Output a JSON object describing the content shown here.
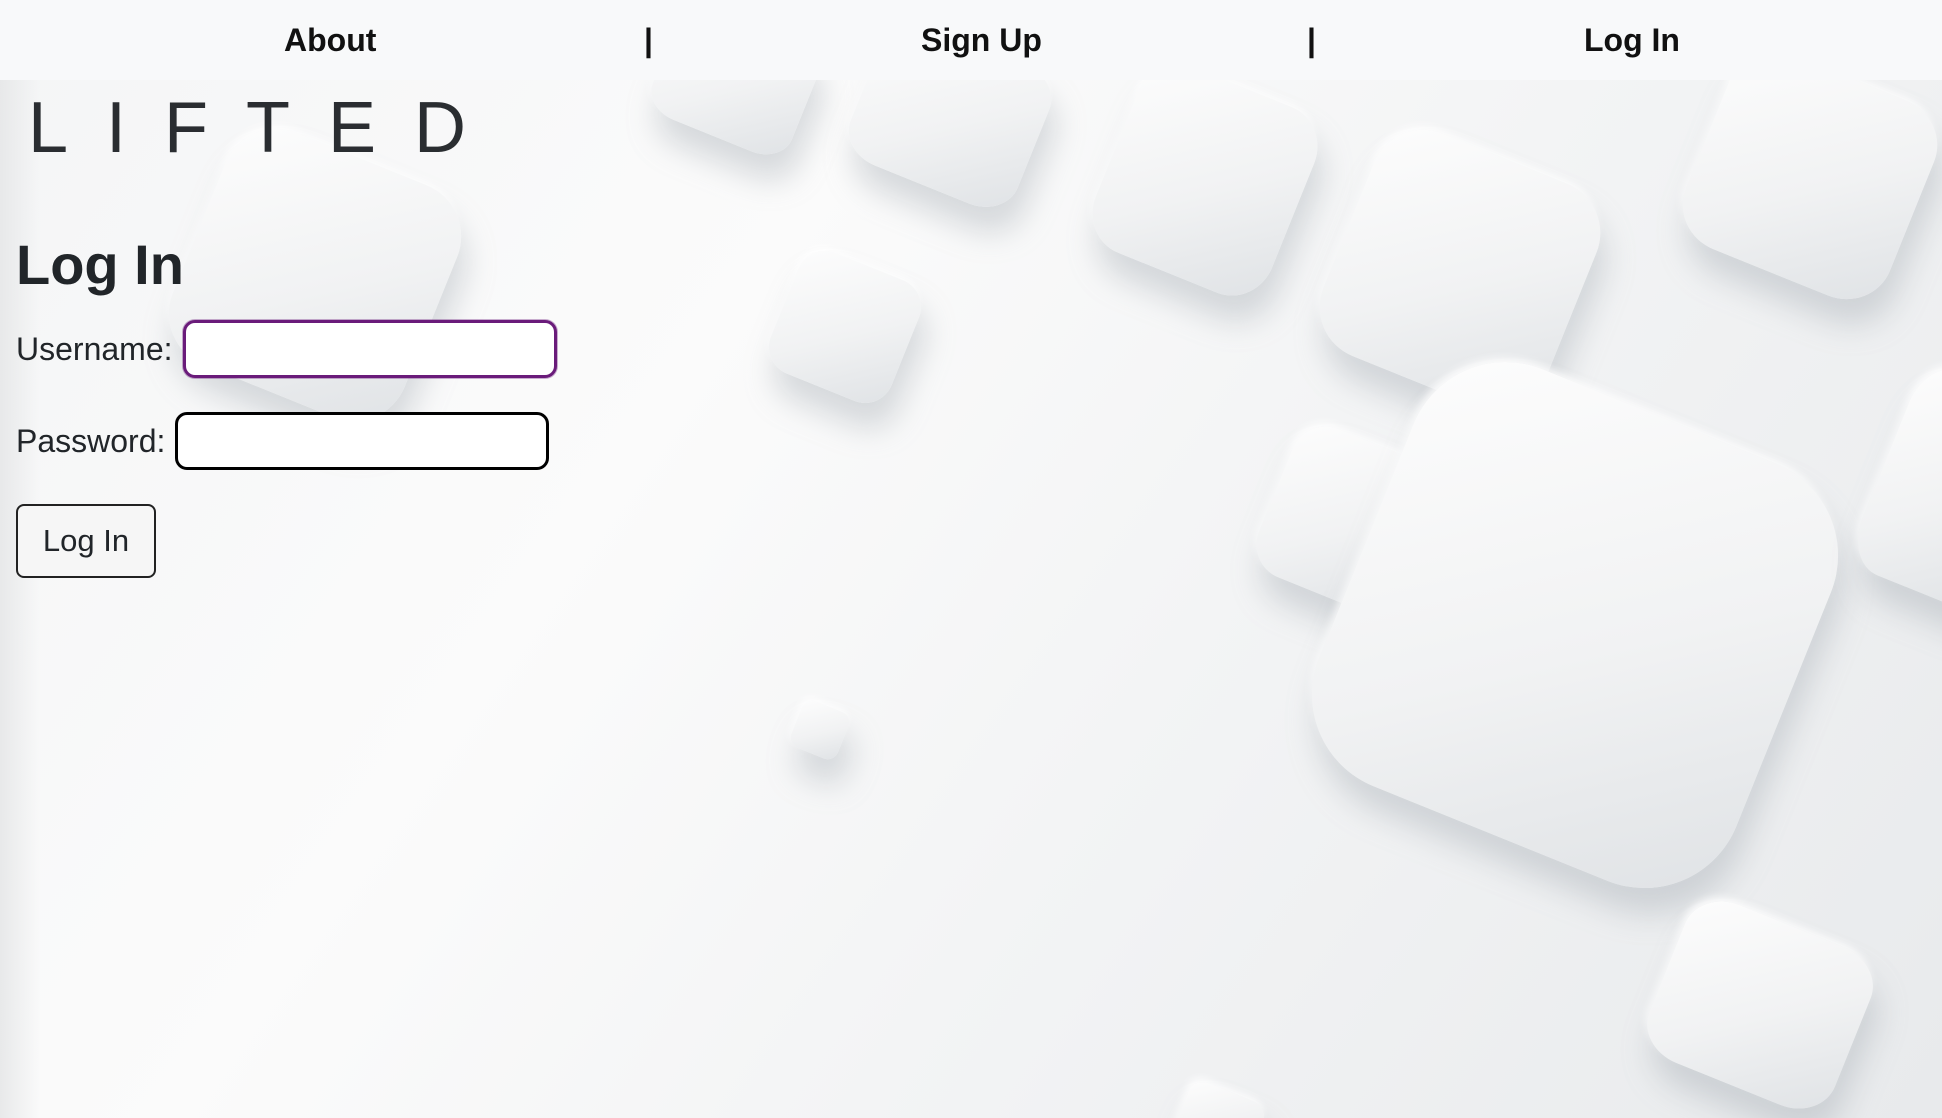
{
  "nav": {
    "about": "About",
    "separator": "|",
    "sign_up": "Sign Up",
    "log_in": "Log In"
  },
  "brand": "LIFTED",
  "login_form": {
    "title": "Log In",
    "username_label": "Username:",
    "username_value": "",
    "password_label": "Password:",
    "password_value": "",
    "submit_label": "Log In"
  },
  "colors": {
    "navbar_background": "#f8f9fa",
    "focused_input_border": "#6a1b7a",
    "text": "#212529"
  }
}
